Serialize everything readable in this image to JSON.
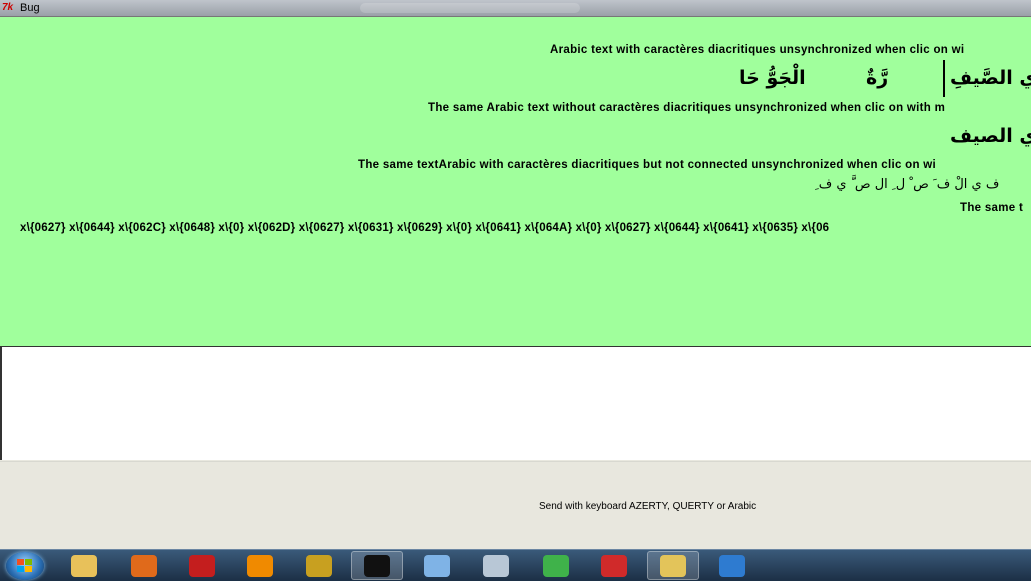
{
  "window": {
    "title": "Bug",
    "app_icon_text": "7k"
  },
  "canvas": {
    "line1_caption": "Arabic text with caractères diacritiques unsynchronized when clic on wi",
    "line1_arabic_a": "الْجَوُّ حَا",
    "line1_arabic_b": "رَّةٌ",
    "line1_arabic_c": "ي الصَّيفِ",
    "line2_caption": "The same Arabic text without caractères diacritiques unsynchronized when clic on with m",
    "line2_arabic": "ي الصيف",
    "line3_caption": "The same textArabic with caractères diacritiques but not connected unsynchronized when clic on wi",
    "line3_arabic": "ف ي الْ ف َ ص ْ ل ِ ال ص َّ ي ف ِ",
    "line4_caption": "The same t",
    "codes_line": "x\\{0627} x\\{0644} x\\{062C} x\\{0648} x\\{0} x\\{062D} x\\{0627} x\\{0631} x\\{0629} x\\{0} x\\{0641} x\\{064A} x\\{0} x\\{0627} x\\{0644} x\\{0641} x\\{0635} x\\{06"
  },
  "entry": {
    "value": ""
  },
  "footer": {
    "hint": "Send with keyboard AZERTY, QUERTY or Arabic"
  },
  "taskbar": {
    "items": [
      {
        "name": "explorer-icon",
        "color": "#e8c15a"
      },
      {
        "name": "firefox-icon",
        "color": "#e06a1b"
      },
      {
        "name": "filezilla-icon",
        "color": "#c41e1e"
      },
      {
        "name": "audacity-icon",
        "color": "#f08a00"
      },
      {
        "name": "ultraedit-icon",
        "color": "#c8a020"
      },
      {
        "name": "cmd-icon",
        "color": "#111111"
      },
      {
        "name": "notepad-icon",
        "color": "#7fb3e6"
      },
      {
        "name": "media-icon",
        "color": "#b8c7d6"
      },
      {
        "name": "dragon-icon",
        "color": "#3fb24a"
      },
      {
        "name": "pen-icon",
        "color": "#d02a2a"
      },
      {
        "name": "network-folder-icon",
        "color": "#e3c45a"
      },
      {
        "name": "mail-icon",
        "color": "#2e7bd0"
      }
    ]
  },
  "colors": {
    "canvas_bg": "#a0ff9c",
    "footer_bg": "#e8e7de"
  }
}
